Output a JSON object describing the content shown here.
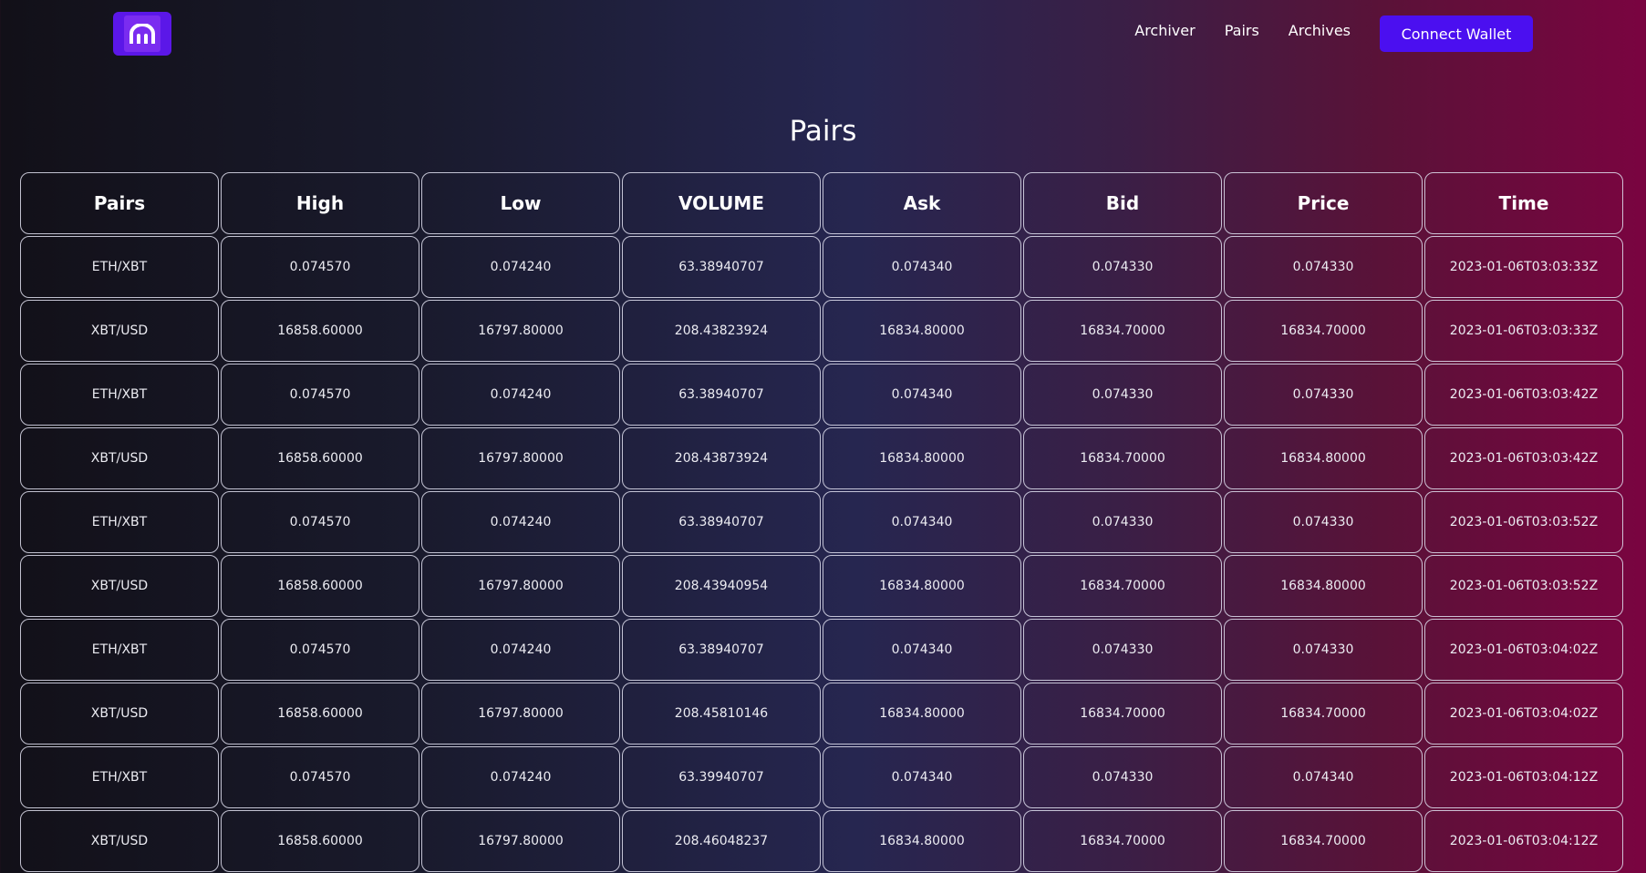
{
  "nav": {
    "links": [
      "Archiver",
      "Pairs",
      "Archives"
    ],
    "connect_button": "Connect Wallet"
  },
  "page": {
    "title": "Pairs"
  },
  "colors": {
    "accent": "#4b0ff0",
    "logo_bg": "#5b17e8"
  },
  "icons": {
    "logo": "kraken-logo-icon"
  },
  "table": {
    "headers": [
      "Pairs",
      "High",
      "Low",
      "VOLUME",
      "Ask",
      "Bid",
      "Price",
      "Time"
    ],
    "rows": [
      [
        "ETH/XBT",
        "0.074570",
        "0.074240",
        "63.38940707",
        "0.074340",
        "0.074330",
        "0.074330",
        "2023-01-06T03:03:33Z"
      ],
      [
        "XBT/USD",
        "16858.60000",
        "16797.80000",
        "208.43823924",
        "16834.80000",
        "16834.70000",
        "16834.70000",
        "2023-01-06T03:03:33Z"
      ],
      [
        "ETH/XBT",
        "0.074570",
        "0.074240",
        "63.38940707",
        "0.074340",
        "0.074330",
        "0.074330",
        "2023-01-06T03:03:42Z"
      ],
      [
        "XBT/USD",
        "16858.60000",
        "16797.80000",
        "208.43873924",
        "16834.80000",
        "16834.70000",
        "16834.80000",
        "2023-01-06T03:03:42Z"
      ],
      [
        "ETH/XBT",
        "0.074570",
        "0.074240",
        "63.38940707",
        "0.074340",
        "0.074330",
        "0.074330",
        "2023-01-06T03:03:52Z"
      ],
      [
        "XBT/USD",
        "16858.60000",
        "16797.80000",
        "208.43940954",
        "16834.80000",
        "16834.70000",
        "16834.80000",
        "2023-01-06T03:03:52Z"
      ],
      [
        "ETH/XBT",
        "0.074570",
        "0.074240",
        "63.38940707",
        "0.074340",
        "0.074330",
        "0.074330",
        "2023-01-06T03:04:02Z"
      ],
      [
        "XBT/USD",
        "16858.60000",
        "16797.80000",
        "208.45810146",
        "16834.80000",
        "16834.70000",
        "16834.70000",
        "2023-01-06T03:04:02Z"
      ],
      [
        "ETH/XBT",
        "0.074570",
        "0.074240",
        "63.39940707",
        "0.074340",
        "0.074330",
        "0.074340",
        "2023-01-06T03:04:12Z"
      ],
      [
        "XBT/USD",
        "16858.60000",
        "16797.80000",
        "208.46048237",
        "16834.80000",
        "16834.70000",
        "16834.70000",
        "2023-01-06T03:04:12Z"
      ]
    ]
  }
}
